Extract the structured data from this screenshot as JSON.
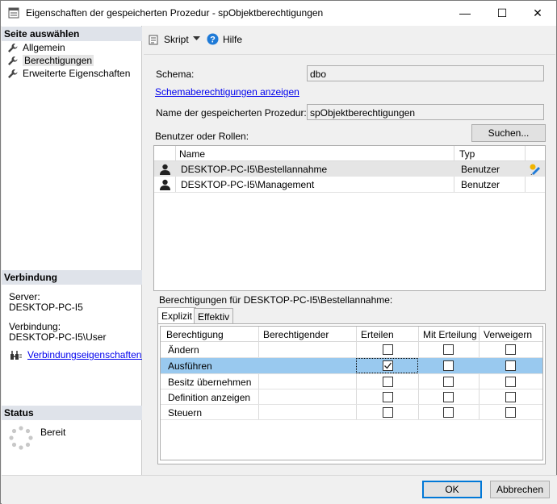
{
  "window": {
    "title": "Eigenschaften der gespeicherten Prozedur - spObjektberechtigungen",
    "minimize": "—",
    "maximize": "☐",
    "close": "✕"
  },
  "left": {
    "select_page_header": "Seite auswählen",
    "nav": [
      {
        "label": "Allgemein",
        "icon": "wrench-icon",
        "selected": false
      },
      {
        "label": "Berechtigungen",
        "icon": "wrench-icon",
        "selected": true
      },
      {
        "label": "Erweiterte Eigenschaften",
        "icon": "wrench-icon",
        "selected": false
      }
    ],
    "connection_header": "Verbindung",
    "server_label": "Server:",
    "server_value": "DESKTOP-PC-I5",
    "connection_label": "Verbindung:",
    "connection_value": "DESKTOP-PC-I5\\User",
    "connection_link": "Verbindungseigenschaften anzeigen",
    "status_header": "Status",
    "status_value": "Bereit"
  },
  "toolbar": {
    "script_label": "Skript",
    "help_label": "Hilfe"
  },
  "form": {
    "schema_label": "Schema:",
    "schema_value": "dbo",
    "schema_permissions_link": "Schemaberechtigungen anzeigen",
    "procedure_name_label": "Name der gespeicherten Prozedur:",
    "procedure_name_value": "spObjektberechtigungen",
    "users_roles_label": "Benutzer oder Rollen:",
    "search_button": "Suchen..."
  },
  "principals": {
    "columns": {
      "name": "Name",
      "type": "Typ"
    },
    "rows": [
      {
        "name": "DESKTOP-PC-I5\\Bestellannahme",
        "type": "Benutzer",
        "selected": true
      },
      {
        "name": "DESKTOP-PC-I5\\Management",
        "type": "Benutzer",
        "selected": false
      }
    ]
  },
  "permissions": {
    "label": "Berechtigungen für DESKTOP-PC-I5\\Bestellannahme:",
    "tabs": [
      {
        "label": "Explizit",
        "active": true
      },
      {
        "label": "Effektiv",
        "active": false
      }
    ],
    "columns": {
      "permission": "Berechtigung",
      "grantor": "Berechtigender",
      "grant": "Erteilen",
      "with_grant": "Mit Erteilung",
      "deny": "Verweigern"
    },
    "rows": [
      {
        "permission": "Ändern",
        "grantor": "",
        "grant": false,
        "with_grant": false,
        "deny": false,
        "selected": false
      },
      {
        "permission": "Ausführen",
        "grantor": "",
        "grant": true,
        "with_grant": false,
        "deny": false,
        "selected": true
      },
      {
        "permission": "Besitz übernehmen",
        "grantor": "",
        "grant": false,
        "with_grant": false,
        "deny": false,
        "selected": false
      },
      {
        "permission": "Definition anzeigen",
        "grantor": "",
        "grant": false,
        "with_grant": false,
        "deny": false,
        "selected": false
      },
      {
        "permission": "Steuern",
        "grantor": "",
        "grant": false,
        "with_grant": false,
        "deny": false,
        "selected": false
      }
    ]
  },
  "footer": {
    "ok_label": "OK",
    "cancel_label": "Abbrechen"
  },
  "colors": {
    "section_header_bg": "#dfe3ea",
    "selected_row_bg": "#e5e5e5",
    "selected_perm_row_bg": "#99c9ef",
    "accent": "#0078d7",
    "link": "#0000ee"
  }
}
